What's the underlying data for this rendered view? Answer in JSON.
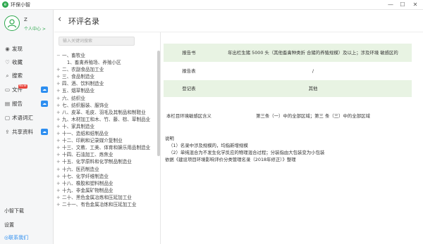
{
  "window": {
    "title": "环保小智",
    "logo_glyph": "e",
    "controls": [
      "—",
      "☐",
      "✕"
    ]
  },
  "user": {
    "name": "Z",
    "center_link": "个人中心 >"
  },
  "sidebar": {
    "items": [
      {
        "icon": "eye-icon",
        "label": "发现"
      },
      {
        "icon": "heart-icon",
        "label": "收藏"
      },
      {
        "icon": "search-icon",
        "label": "搜索"
      },
      {
        "icon": "folder-icon",
        "label": "文件",
        "badge": "NEW",
        "cloud": true
      },
      {
        "icon": "report-icon",
        "label": "报告",
        "cloud": true
      },
      {
        "icon": "chat-icon",
        "label": "术语词汇"
      },
      {
        "icon": "share-icon",
        "label": "共享资料",
        "cloud": true
      }
    ],
    "bottom": {
      "download": "小智下载",
      "settings": "设置",
      "contact": "联系我们"
    }
  },
  "header": {
    "title": "环评名录"
  },
  "search": {
    "placeholder": "输入关键词搜索"
  },
  "categories": [
    {
      "label": "一、畜牧业",
      "toggle": "−"
    },
    {
      "label": "1、畜禽养殖场、养殖小区",
      "sub": true
    },
    {
      "label": "二、农副食品加工业",
      "toggle": "+"
    },
    {
      "label": "三、食品制造业",
      "toggle": "+"
    },
    {
      "label": "四、酒、饮料制造业",
      "toggle": "+"
    },
    {
      "label": "五、烟草制品业",
      "toggle": "+"
    },
    {
      "label": "六、纺织业",
      "toggle": "+"
    },
    {
      "label": "七、纺织服装、服饰业",
      "toggle": "+"
    },
    {
      "label": "八、皮革、毛皮、羽毛及其制品和制鞋业",
      "toggle": "+"
    },
    {
      "label": "九、木材加工和木、竹、藤、棕、草制品业",
      "toggle": "+"
    },
    {
      "label": "十、家具制造业",
      "toggle": "+"
    },
    {
      "label": "十一、造纸和纸制品业",
      "toggle": "+"
    },
    {
      "label": "十二、印刷和记录媒介复制业",
      "toggle": "+"
    },
    {
      "label": "十三、文教、工美、体育和娱乐用品制造业",
      "toggle": "+"
    },
    {
      "label": "十四、石油加工、炼焦业",
      "toggle": "+"
    },
    {
      "label": "十五、化学原料和化学制品制造业",
      "toggle": "+"
    },
    {
      "label": "十六、医药制造业",
      "toggle": "+"
    },
    {
      "label": "十七、化学纤维制造业",
      "toggle": "+"
    },
    {
      "label": "十八、橡胶和塑料制品业",
      "toggle": "+"
    },
    {
      "label": "十九、非金属矿物制品业",
      "toggle": "+"
    },
    {
      "label": "二十、黑色金属冶炼和压延加工业",
      "toggle": "+"
    },
    {
      "label": "二十一、有色金属冶炼和压延加工业",
      "toggle": "+"
    }
  ],
  "table": [
    {
      "key": "报告书",
      "value": "年出栏生猪 5000 头（其他畜禽种类折 合猪的养殖规模）及以上；涉及环境 敏感区的",
      "shade": true
    },
    {
      "key": "报告表",
      "value": "/",
      "shade": false
    },
    {
      "key": "登记表",
      "value": "其他",
      "shade": true
    },
    {
      "key": "本栏目环境敏感区含义",
      "value": "第三条（一）中的全部区域；第三 条（三）中的全部区域",
      "shade": false
    }
  ],
  "notes": {
    "heading": "说明",
    "lines": [
      "（1）名录中涉及规模的，均指新增规模",
      "（2）单纯混合为不发生化学反应的物理混合过程；分装指由大包装变为小包装",
      "依据《建设项目环境影响评价分类管理名录（2018年修正）》整理"
    ]
  }
}
